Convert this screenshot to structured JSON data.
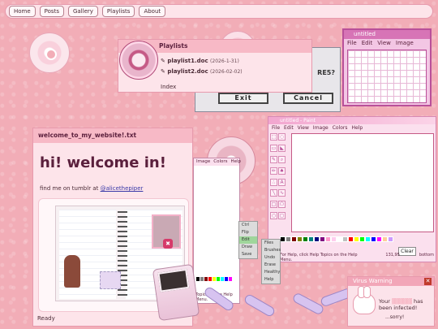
{
  "nav": {
    "items": [
      {
        "label": "Home"
      },
      {
        "label": "Posts"
      },
      {
        "label": "Gallery"
      },
      {
        "label": "Playlists"
      },
      {
        "label": "About"
      }
    ]
  },
  "playlists": {
    "title": "Playlists",
    "files": [
      {
        "name": "playlist1.doc",
        "date": "(2026-1-31)"
      },
      {
        "name": "playlist2.doc",
        "date": "(2026-02-02)"
      }
    ],
    "index_label": "Index"
  },
  "dialog": {
    "text": "RE5?",
    "exit_label": "Exit",
    "cancel_label": "Cancel"
  },
  "untitled_paint": {
    "title": "untitled",
    "menu": [
      "File",
      "Edit",
      "View",
      "Image"
    ]
  },
  "paint_main": {
    "title": "untitled - Paint",
    "menu": [
      "File",
      "Edit",
      "View",
      "Image",
      "Colors",
      "Help"
    ],
    "status": "For Help, click Help Topics on the Help Menu.",
    "coord1": "131,95",
    "coord2": "bottom",
    "clear_label": "Clear",
    "palette": [
      "#000000",
      "#808080",
      "#800000",
      "#808000",
      "#008000",
      "#008080",
      "#000080",
      "#800080",
      "#ff99cc",
      "#ffccee",
      "#ffffff",
      "#c0c0c0",
      "#ff0000",
      "#ffff00",
      "#00ff00",
      "#00ffff",
      "#0000ff",
      "#ff00ff",
      "#ffcc99",
      "#cc99ff"
    ],
    "side_menu": [
      "Files",
      "Brushes",
      "Undo",
      "Erase",
      "Healthy",
      "Help"
    ]
  },
  "paint_mid": {
    "menu": [
      "Image",
      "Colors",
      "Help"
    ],
    "help_text": "Topics on the Help Menu.",
    "palette": [
      "#000000",
      "#808080",
      "#800000",
      "#ff0000",
      "#ffff00",
      "#00ff00",
      "#00ffff",
      "#0000ff",
      "#ff00ff",
      "#ffffff"
    ]
  },
  "mini_menu": [
    "Ctrl",
    "Flip",
    "Edit",
    "Draw",
    "Save"
  ],
  "welcome": {
    "title": "welcome_to_my_website!.txt",
    "heading": "hi! welcome in!",
    "tumblr_prefix": "find me on tumblr at ",
    "tumblr_handle": "@alicethepiper",
    "status": "Ready"
  },
  "virus": {
    "title": "Virus Warning",
    "close": "✕",
    "line1": "Your",
    "line1b": "has",
    "line2": "been infected!",
    "line3": "...sorry!"
  }
}
